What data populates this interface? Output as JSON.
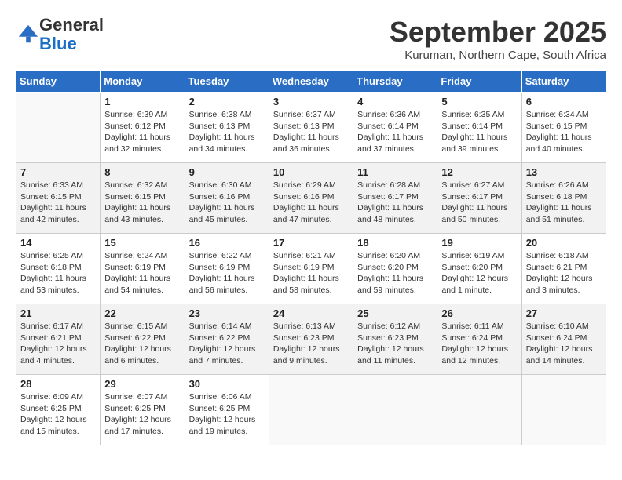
{
  "logo": {
    "general": "General",
    "blue": "Blue"
  },
  "header": {
    "month": "September 2025",
    "location": "Kuruman, Northern Cape, South Africa"
  },
  "days_of_week": [
    "Sunday",
    "Monday",
    "Tuesday",
    "Wednesday",
    "Thursday",
    "Friday",
    "Saturday"
  ],
  "weeks": [
    [
      {
        "num": "",
        "info": ""
      },
      {
        "num": "1",
        "info": "Sunrise: 6:39 AM\nSunset: 6:12 PM\nDaylight: 11 hours\nand 32 minutes."
      },
      {
        "num": "2",
        "info": "Sunrise: 6:38 AM\nSunset: 6:13 PM\nDaylight: 11 hours\nand 34 minutes."
      },
      {
        "num": "3",
        "info": "Sunrise: 6:37 AM\nSunset: 6:13 PM\nDaylight: 11 hours\nand 36 minutes."
      },
      {
        "num": "4",
        "info": "Sunrise: 6:36 AM\nSunset: 6:14 PM\nDaylight: 11 hours\nand 37 minutes."
      },
      {
        "num": "5",
        "info": "Sunrise: 6:35 AM\nSunset: 6:14 PM\nDaylight: 11 hours\nand 39 minutes."
      },
      {
        "num": "6",
        "info": "Sunrise: 6:34 AM\nSunset: 6:15 PM\nDaylight: 11 hours\nand 40 minutes."
      }
    ],
    [
      {
        "num": "7",
        "info": "Sunrise: 6:33 AM\nSunset: 6:15 PM\nDaylight: 11 hours\nand 42 minutes."
      },
      {
        "num": "8",
        "info": "Sunrise: 6:32 AM\nSunset: 6:15 PM\nDaylight: 11 hours\nand 43 minutes."
      },
      {
        "num": "9",
        "info": "Sunrise: 6:30 AM\nSunset: 6:16 PM\nDaylight: 11 hours\nand 45 minutes."
      },
      {
        "num": "10",
        "info": "Sunrise: 6:29 AM\nSunset: 6:16 PM\nDaylight: 11 hours\nand 47 minutes."
      },
      {
        "num": "11",
        "info": "Sunrise: 6:28 AM\nSunset: 6:17 PM\nDaylight: 11 hours\nand 48 minutes."
      },
      {
        "num": "12",
        "info": "Sunrise: 6:27 AM\nSunset: 6:17 PM\nDaylight: 11 hours\nand 50 minutes."
      },
      {
        "num": "13",
        "info": "Sunrise: 6:26 AM\nSunset: 6:18 PM\nDaylight: 11 hours\nand 51 minutes."
      }
    ],
    [
      {
        "num": "14",
        "info": "Sunrise: 6:25 AM\nSunset: 6:18 PM\nDaylight: 11 hours\nand 53 minutes."
      },
      {
        "num": "15",
        "info": "Sunrise: 6:24 AM\nSunset: 6:19 PM\nDaylight: 11 hours\nand 54 minutes."
      },
      {
        "num": "16",
        "info": "Sunrise: 6:22 AM\nSunset: 6:19 PM\nDaylight: 11 hours\nand 56 minutes."
      },
      {
        "num": "17",
        "info": "Sunrise: 6:21 AM\nSunset: 6:19 PM\nDaylight: 11 hours\nand 58 minutes."
      },
      {
        "num": "18",
        "info": "Sunrise: 6:20 AM\nSunset: 6:20 PM\nDaylight: 11 hours\nand 59 minutes."
      },
      {
        "num": "19",
        "info": "Sunrise: 6:19 AM\nSunset: 6:20 PM\nDaylight: 12 hours\nand 1 minute."
      },
      {
        "num": "20",
        "info": "Sunrise: 6:18 AM\nSunset: 6:21 PM\nDaylight: 12 hours\nand 3 minutes."
      }
    ],
    [
      {
        "num": "21",
        "info": "Sunrise: 6:17 AM\nSunset: 6:21 PM\nDaylight: 12 hours\nand 4 minutes."
      },
      {
        "num": "22",
        "info": "Sunrise: 6:15 AM\nSunset: 6:22 PM\nDaylight: 12 hours\nand 6 minutes."
      },
      {
        "num": "23",
        "info": "Sunrise: 6:14 AM\nSunset: 6:22 PM\nDaylight: 12 hours\nand 7 minutes."
      },
      {
        "num": "24",
        "info": "Sunrise: 6:13 AM\nSunset: 6:23 PM\nDaylight: 12 hours\nand 9 minutes."
      },
      {
        "num": "25",
        "info": "Sunrise: 6:12 AM\nSunset: 6:23 PM\nDaylight: 12 hours\nand 11 minutes."
      },
      {
        "num": "26",
        "info": "Sunrise: 6:11 AM\nSunset: 6:24 PM\nDaylight: 12 hours\nand 12 minutes."
      },
      {
        "num": "27",
        "info": "Sunrise: 6:10 AM\nSunset: 6:24 PM\nDaylight: 12 hours\nand 14 minutes."
      }
    ],
    [
      {
        "num": "28",
        "info": "Sunrise: 6:09 AM\nSunset: 6:25 PM\nDaylight: 12 hours\nand 15 minutes."
      },
      {
        "num": "29",
        "info": "Sunrise: 6:07 AM\nSunset: 6:25 PM\nDaylight: 12 hours\nand 17 minutes."
      },
      {
        "num": "30",
        "info": "Sunrise: 6:06 AM\nSunset: 6:25 PM\nDaylight: 12 hours\nand 19 minutes."
      },
      {
        "num": "",
        "info": ""
      },
      {
        "num": "",
        "info": ""
      },
      {
        "num": "",
        "info": ""
      },
      {
        "num": "",
        "info": ""
      }
    ]
  ]
}
